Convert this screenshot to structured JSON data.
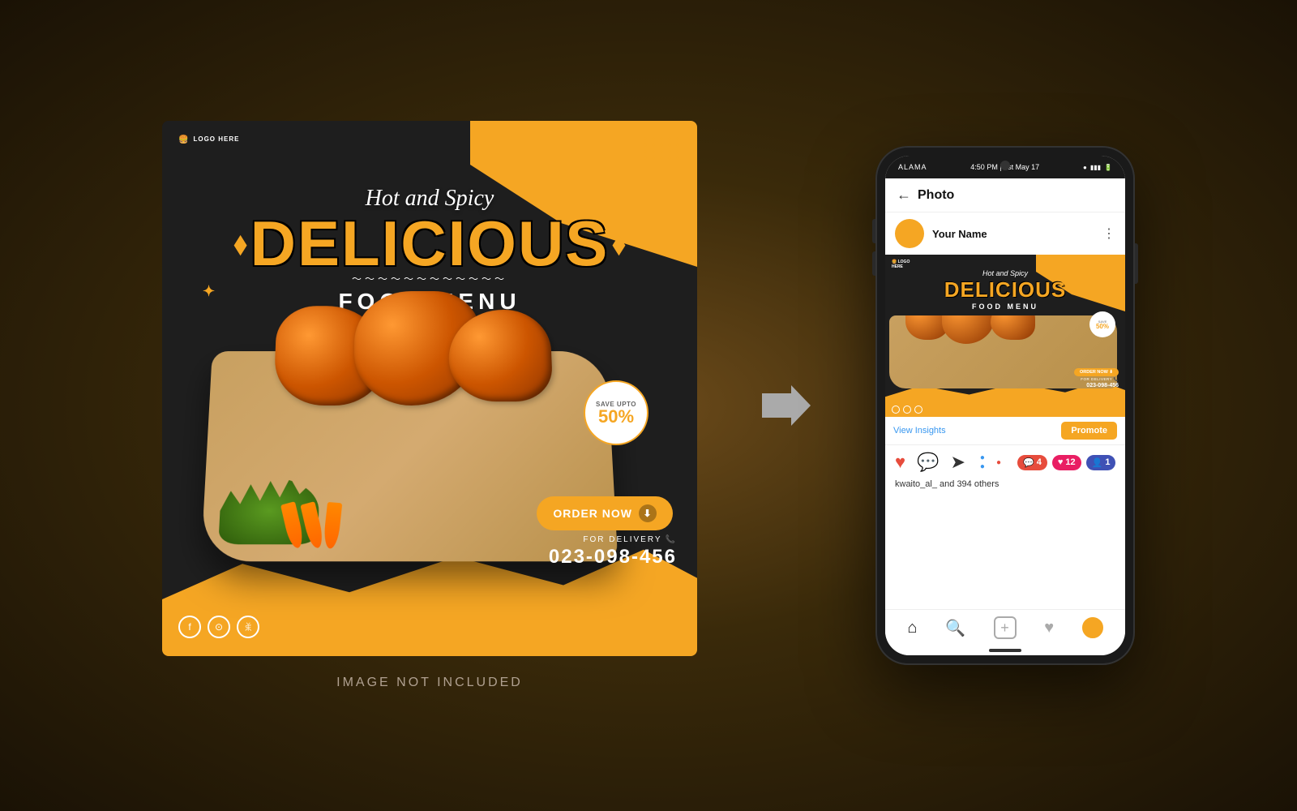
{
  "page": {
    "background": "#3a2a0a",
    "image_not_included": "IMAGE NOT INCLUDED"
  },
  "post_card": {
    "logo_text": "LOGO\nHERE",
    "hot_spicy": "Hot and Spicy",
    "delicious": "DELICIOUS",
    "food_menu": "FOOD MENU",
    "save_upto": "SAVE UPTO",
    "save_percent": "50%",
    "order_now": "ORDER NOW",
    "for_delivery": "FOR DELIVERY",
    "phone_number": "023-098-456"
  },
  "phone": {
    "status_left": "ALAMA",
    "status_time": "4:50 PM | 1st May 17",
    "header_title": "Photo",
    "author_name": "Your Name",
    "view_insights": "View Insights",
    "promote": "Promote",
    "likes_text": "kwaito_al_ and 394 others",
    "notification_comments": "4",
    "notification_likes": "12",
    "notification_follow": "1"
  }
}
